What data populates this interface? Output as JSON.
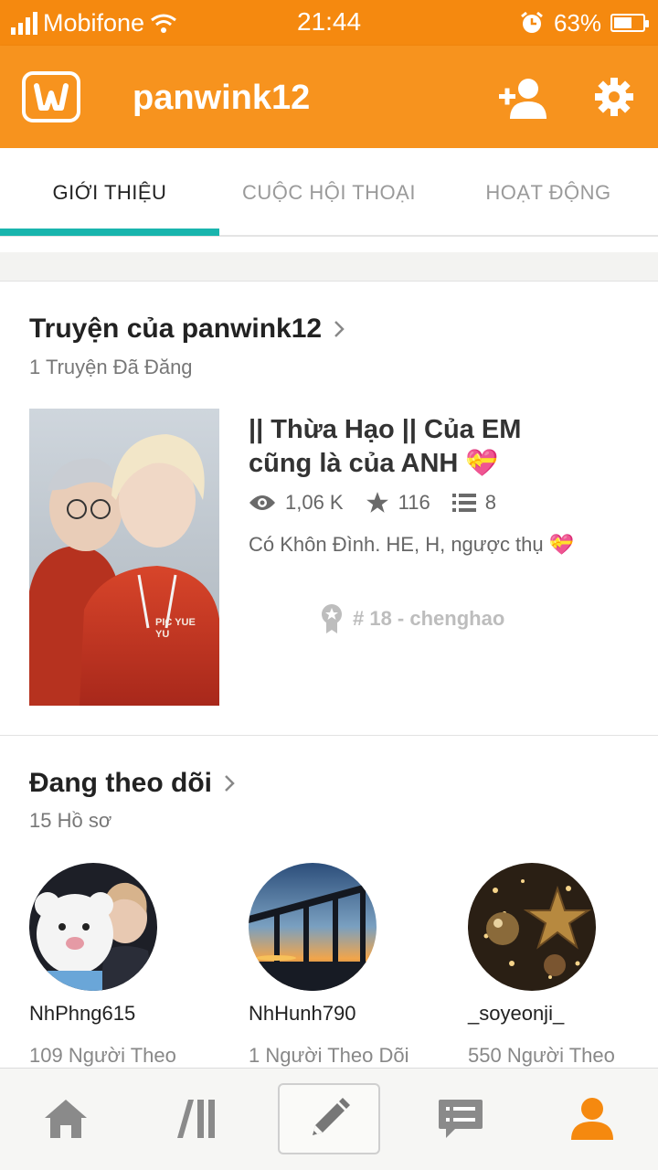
{
  "status_bar": {
    "carrier": "Mobifone",
    "time": "21:44",
    "battery": "63%",
    "battery_level": 0.63
  },
  "header": {
    "title": "panwink12",
    "icons": [
      "wattpad-logo-icon",
      "add-friend-icon",
      "gear-icon"
    ]
  },
  "tabs": [
    {
      "label": "GIỚI THIỆU",
      "active": true
    },
    {
      "label": "CUỘC HỘI THOẠI",
      "active": false
    },
    {
      "label": "HOẠT ĐỘNG",
      "active": false
    }
  ],
  "stories": {
    "heading": "Truyện của panwink12",
    "subheading": "1 Truyện Đã Đăng",
    "story": {
      "title": "|| Thừa Hạo || Của EM cũng là của ANH 💝",
      "views": "1,06 K",
      "votes": "116",
      "parts": "8",
      "description": "Có Khôn Đình. HE, H, ngược thụ 💝",
      "rank": "# 18 - chenghao",
      "cover_hoodie_text": "PIC YUE YU"
    }
  },
  "following": {
    "heading": "Đang theo dõi",
    "subheading": "15 Hồ sơ",
    "users": [
      {
        "name": "NhPhng615",
        "followers": "109 Người Theo"
      },
      {
        "name": "NhHunh790",
        "followers": "1 Người Theo Dõi"
      },
      {
        "name": "_soyeonji_",
        "followers": "550 Người Theo"
      }
    ]
  },
  "bottom_nav": {
    "items": [
      "home-icon",
      "library-icon",
      "write-icon",
      "messages-icon",
      "profile-icon"
    ],
    "active_color": "#f5890f",
    "inactive_color": "#8a8a8a"
  },
  "colors": {
    "brand_orange": "#f7931e",
    "tab_indicator": "#19b5ad"
  }
}
